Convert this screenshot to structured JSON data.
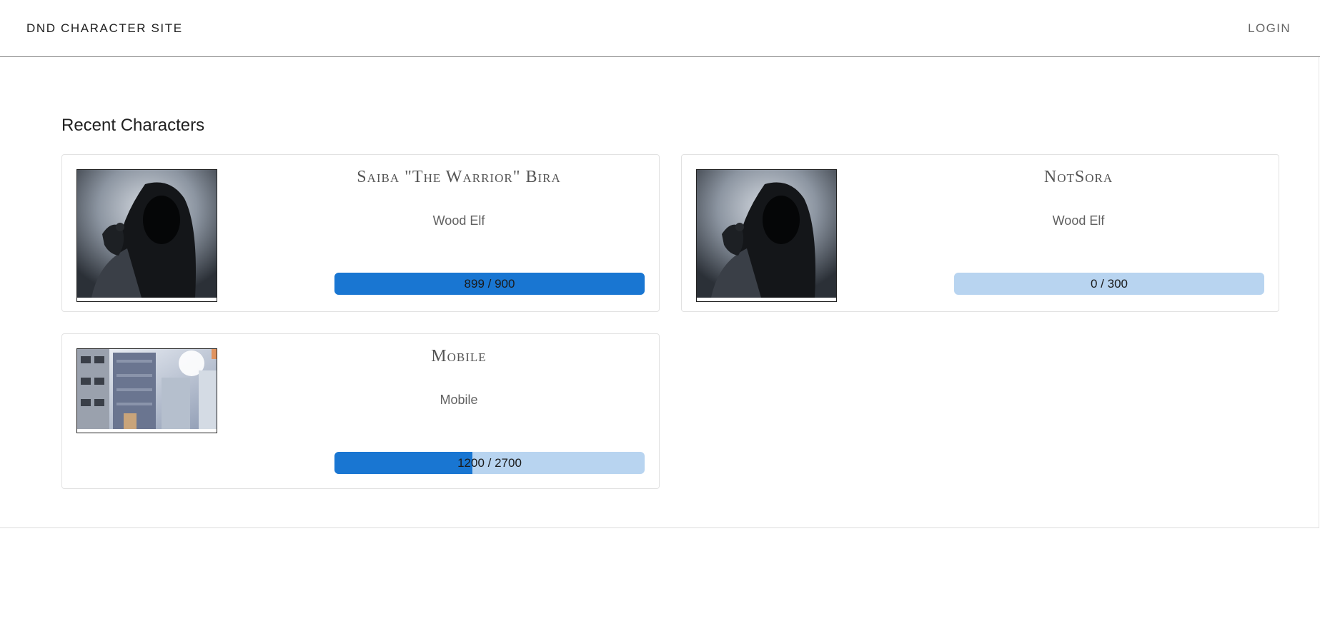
{
  "header": {
    "site_title": "DND CHARACTER SITE",
    "login_label": "LOGIN"
  },
  "main": {
    "section_title": "Recent Characters",
    "characters": [
      {
        "name": "Saiba \"The Warrior\" Bira",
        "race": "Wood Elf",
        "xp_label": "899 / 900",
        "xp_current": 899,
        "xp_max": 900,
        "image": "hooded-figure-with-raven"
      },
      {
        "name": "NotSora",
        "race": "Wood Elf",
        "xp_label": "0 / 300",
        "xp_current": 0,
        "xp_max": 300,
        "image": "hooded-figure-with-raven"
      },
      {
        "name": "Mobile",
        "race": "Mobile",
        "xp_label": "1200 / 2700",
        "xp_current": 1200,
        "xp_max": 2700,
        "image": "city-building-street"
      }
    ]
  },
  "colors": {
    "progress_fill": "#1976d2",
    "progress_track": "#b8d4f0"
  }
}
